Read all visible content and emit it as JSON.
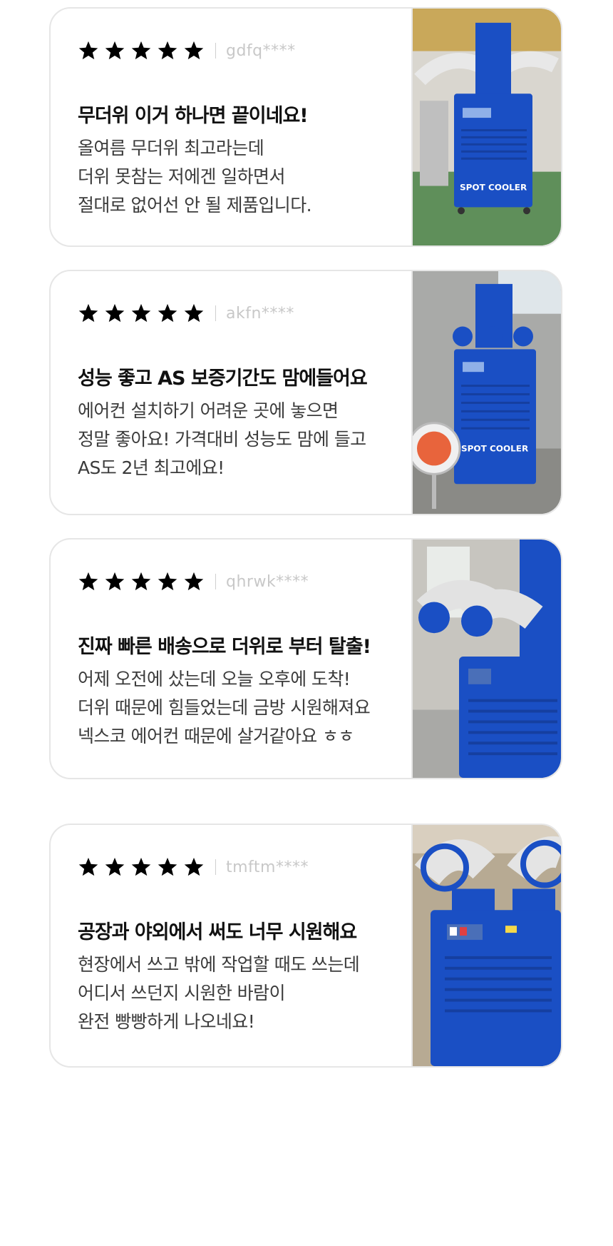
{
  "reviews": [
    {
      "rating": 5,
      "reviewer": "gdfq****",
      "title": "무더위 이거 하나면 끝이네요!",
      "lines": [
        "올여름 무더위 최고라는데",
        "더위 못참는 저에겐 일하면서",
        "절대로 없어선 안 될 제품입니다."
      ],
      "photo_label": "SPOT COOLER"
    },
    {
      "rating": 5,
      "reviewer": "akfn****",
      "title": "성능 좋고 AS 보증기간도 맘에들어요",
      "lines": [
        "에어컨 설치하기 어려운 곳에 놓으면",
        "정말 좋아요! 가격대비 성능도 맘에 들고",
        "AS도 2년 최고에요!"
      ],
      "photo_label": "SPOT COOLER"
    },
    {
      "rating": 5,
      "reviewer": "qhrwk****",
      "title": "진짜 빠른 배송으로 더위로 부터 탈출!",
      "lines": [
        "어제 오전에 샀는데 오늘 오후에 도착!",
        "더위 때문에 힘들었는데 금방 시원해져요",
        "넥스코 에어컨 때문에 살거같아요 ㅎㅎ"
      ],
      "photo_label": ""
    },
    {
      "rating": 5,
      "reviewer": "tmftm****",
      "title": "공장과 야외에서 써도 너무 시원해요",
      "lines": [
        "현장에서 쓰고 밖에 작업할 때도 쓰는데",
        "어디서 쓰던지 시원한 바람이",
        "완전 빵빵하게 나오네요!"
      ],
      "photo_label": ""
    }
  ],
  "colors": {
    "star": "#1f56c8",
    "cooler_blue": "#1a4fc4",
    "border": "#e6e6e6"
  }
}
